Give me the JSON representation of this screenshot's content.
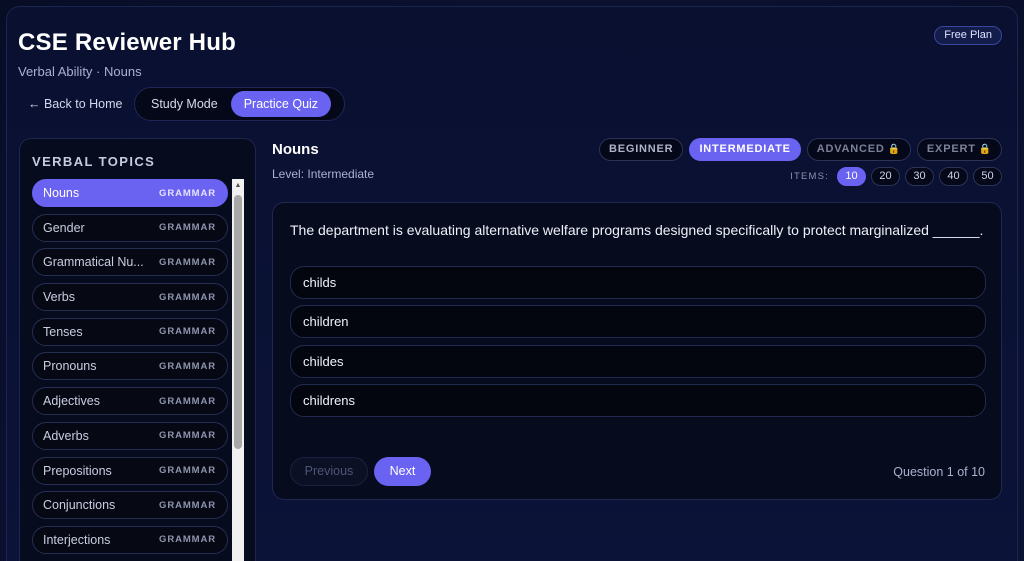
{
  "header": {
    "title": "CSE Reviewer Hub",
    "subtitle": "Verbal Ability · Nouns",
    "plan_badge": "Free Plan",
    "back_label": "← Back to Home"
  },
  "modes": [
    {
      "label": "Study Mode",
      "active": false
    },
    {
      "label": "Practice Quiz",
      "active": true
    }
  ],
  "sidebar": {
    "title": "VERBAL TOPICS",
    "items": [
      {
        "label": "Nouns",
        "tag": "GRAMMAR",
        "active": true
      },
      {
        "label": "Gender",
        "tag": "GRAMMAR"
      },
      {
        "label": "Grammatical Nu...",
        "tag": "GRAMMAR"
      },
      {
        "label": "Verbs",
        "tag": "GRAMMAR"
      },
      {
        "label": "Tenses",
        "tag": "GRAMMAR"
      },
      {
        "label": "Pronouns",
        "tag": "GRAMMAR"
      },
      {
        "label": "Adjectives",
        "tag": "GRAMMAR"
      },
      {
        "label": "Adverbs",
        "tag": "GRAMMAR"
      },
      {
        "label": "Prepositions",
        "tag": "GRAMMAR"
      },
      {
        "label": "Conjunctions",
        "tag": "GRAMMAR"
      },
      {
        "label": "Interjections",
        "tag": "GRAMMAR"
      }
    ],
    "scroll_up_glyph": "▲"
  },
  "main": {
    "topic_title": "Nouns",
    "level_text": "Level: Intermediate",
    "levels": [
      {
        "label": "BEGINNER",
        "active": false,
        "locked": false
      },
      {
        "label": "INTERMEDIATE",
        "active": true,
        "locked": false
      },
      {
        "label": "ADVANCED",
        "active": false,
        "locked": true
      },
      {
        "label": "EXPERT",
        "active": false,
        "locked": true
      }
    ],
    "items_label": "ITEMS:",
    "item_counts": [
      {
        "label": "10",
        "active": true
      },
      {
        "label": "20"
      },
      {
        "label": "30"
      },
      {
        "label": "40"
      },
      {
        "label": "50"
      }
    ],
    "lock_glyph": "🔒"
  },
  "quiz": {
    "question": "The department is evaluating alternative welfare programs designed specifically to protect marginalized ______.",
    "options": [
      "childs",
      "children",
      "childes",
      "childrens"
    ],
    "prev_label": "Previous",
    "next_label": "Next",
    "progress": "Question 1 of 10"
  },
  "colors": {
    "accent": "#6a63f2",
    "background": "#0a1030",
    "panel": "#070b1e"
  }
}
